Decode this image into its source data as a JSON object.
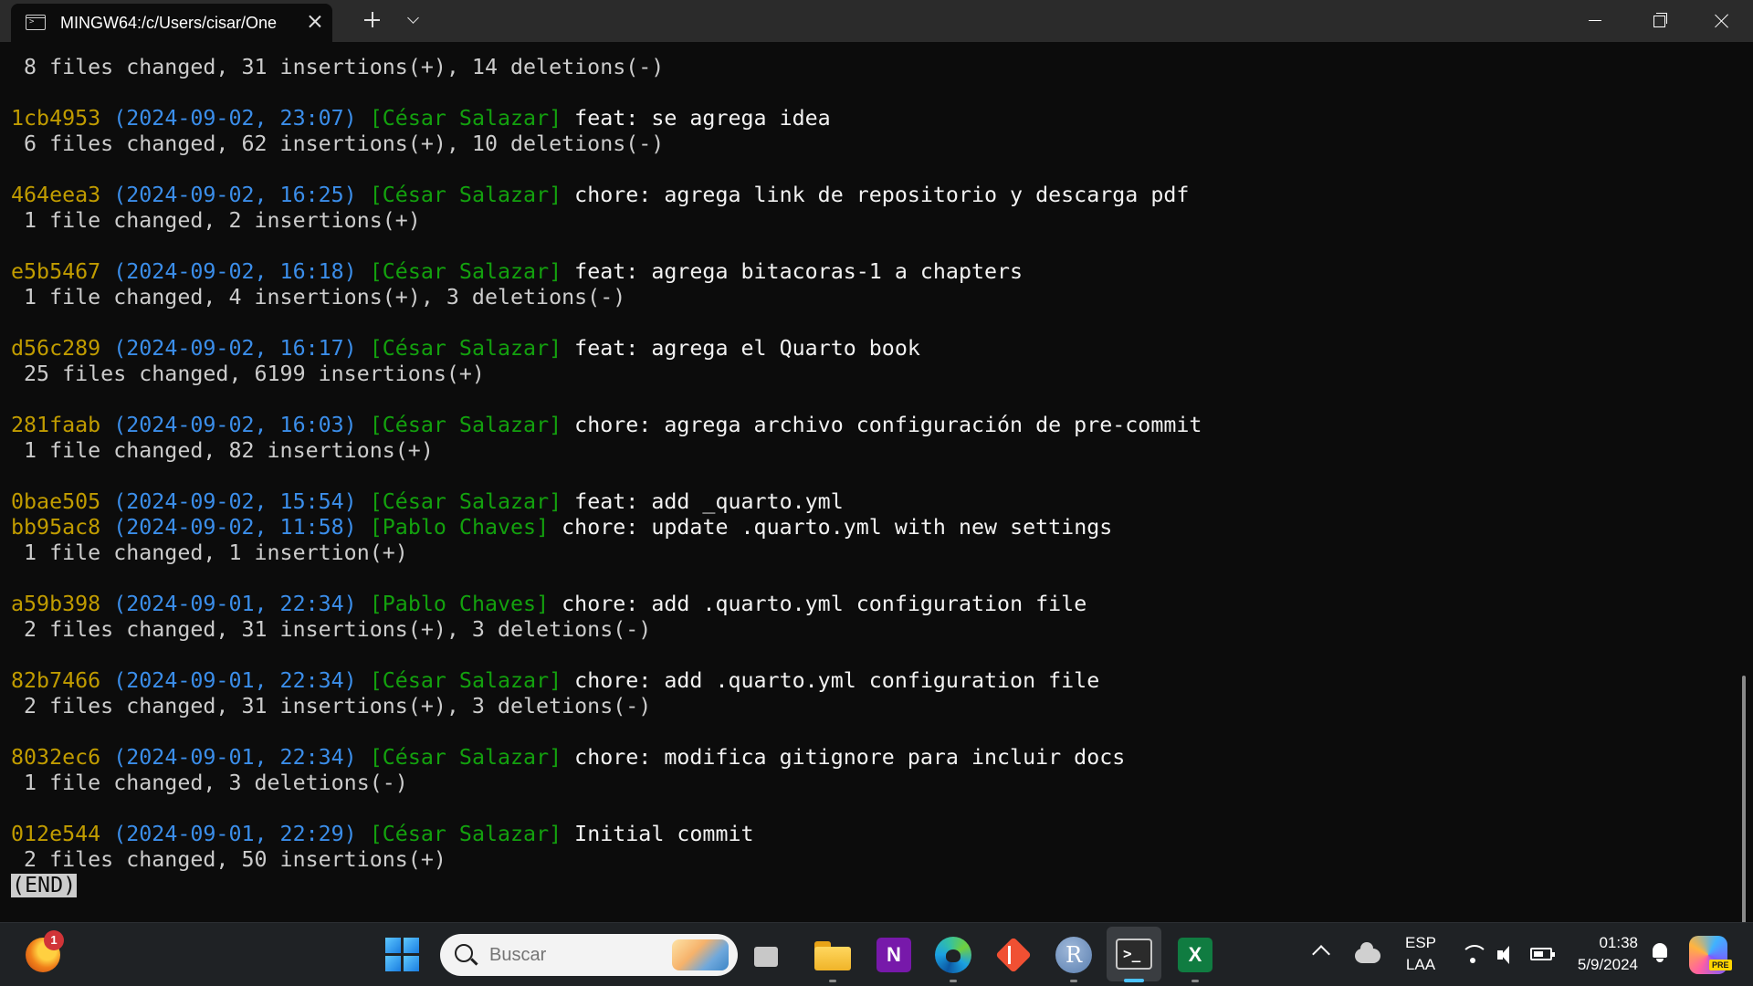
{
  "window": {
    "tab_title": "MINGW64:/c/Users/cisar/One",
    "tab_icon": "terminal-icon"
  },
  "terminal": {
    "first_stat": " 8 files changed, 31 insertions(+), 14 deletions(-)",
    "commits": [
      {
        "hash": "1cb4953",
        "date": "(2024-09-02, 23:07)",
        "author": "[César Salazar]",
        "message": "feat: se agrega idea",
        "stat": " 6 files changed, 62 insertions(+), 10 deletions(-)"
      },
      {
        "hash": "464eea3",
        "date": "(2024-09-02, 16:25)",
        "author": "[César Salazar]",
        "message": "chore: agrega link de repositorio y descarga pdf",
        "stat": " 1 file changed, 2 insertions(+)"
      },
      {
        "hash": "e5b5467",
        "date": "(2024-09-02, 16:18)",
        "author": "[César Salazar]",
        "message": "feat: agrega bitacoras-1 a chapters",
        "stat": " 1 file changed, 4 insertions(+), 3 deletions(-)"
      },
      {
        "hash": "d56c289",
        "date": "(2024-09-02, 16:17)",
        "author": "[César Salazar]",
        "message": "feat: agrega el Quarto book",
        "stat": " 25 files changed, 6199 insertions(+)"
      },
      {
        "hash": "281faab",
        "date": "(2024-09-02, 16:03)",
        "author": "[César Salazar]",
        "message": "chore: agrega archivo configuración de pre-commit",
        "stat": " 1 file changed, 82 insertions(+)"
      },
      {
        "hash": "0bae505",
        "date": "(2024-09-02, 15:54)",
        "author": "[César Salazar]",
        "message": "feat: add _quarto.yml",
        "stat": ""
      },
      {
        "hash": "bb95ac8",
        "date": "(2024-09-02, 11:58)",
        "author": "[Pablo Chaves]",
        "message": "chore: update .quarto.yml with new settings",
        "stat": " 1 file changed, 1 insertion(+)"
      },
      {
        "hash": "a59b398",
        "date": "(2024-09-01, 22:34)",
        "author": "[Pablo Chaves]",
        "message": "chore: add .quarto.yml configuration file",
        "stat": " 2 files changed, 31 insertions(+), 3 deletions(-)"
      },
      {
        "hash": "82b7466",
        "date": "(2024-09-01, 22:34)",
        "author": "[César Salazar]",
        "message": "chore: add .quarto.yml configuration file",
        "stat": " 2 files changed, 31 insertions(+), 3 deletions(-)"
      },
      {
        "hash": "8032ec6",
        "date": "(2024-09-01, 22:34)",
        "author": "[César Salazar]",
        "message": "chore: modifica gitignore para incluir docs",
        "stat": " 1 file changed, 3 deletions(-)"
      },
      {
        "hash": "012e544",
        "date": "(2024-09-01, 22:29)",
        "author": "[César Salazar]",
        "message": "Initial commit",
        "stat": " 2 files changed, 50 insertions(+)"
      }
    ],
    "end_marker": "(END)",
    "colors": {
      "hash": "#c19c00",
      "date": "#3b8eea",
      "author": "#13a10e",
      "text": "#cccccc"
    }
  },
  "taskbar": {
    "weather_badge": "1",
    "search_placeholder": "Buscar",
    "onenote_letter": "N",
    "r_letter": "R",
    "terminal_glyph": ">_",
    "excel_letter": "X",
    "language": {
      "line1": "ESP",
      "line2": "LAA"
    },
    "clock": {
      "time": "01:38",
      "date": "5/9/2024"
    },
    "pre_label": "PRE",
    "accent": "#4cc2ff"
  }
}
